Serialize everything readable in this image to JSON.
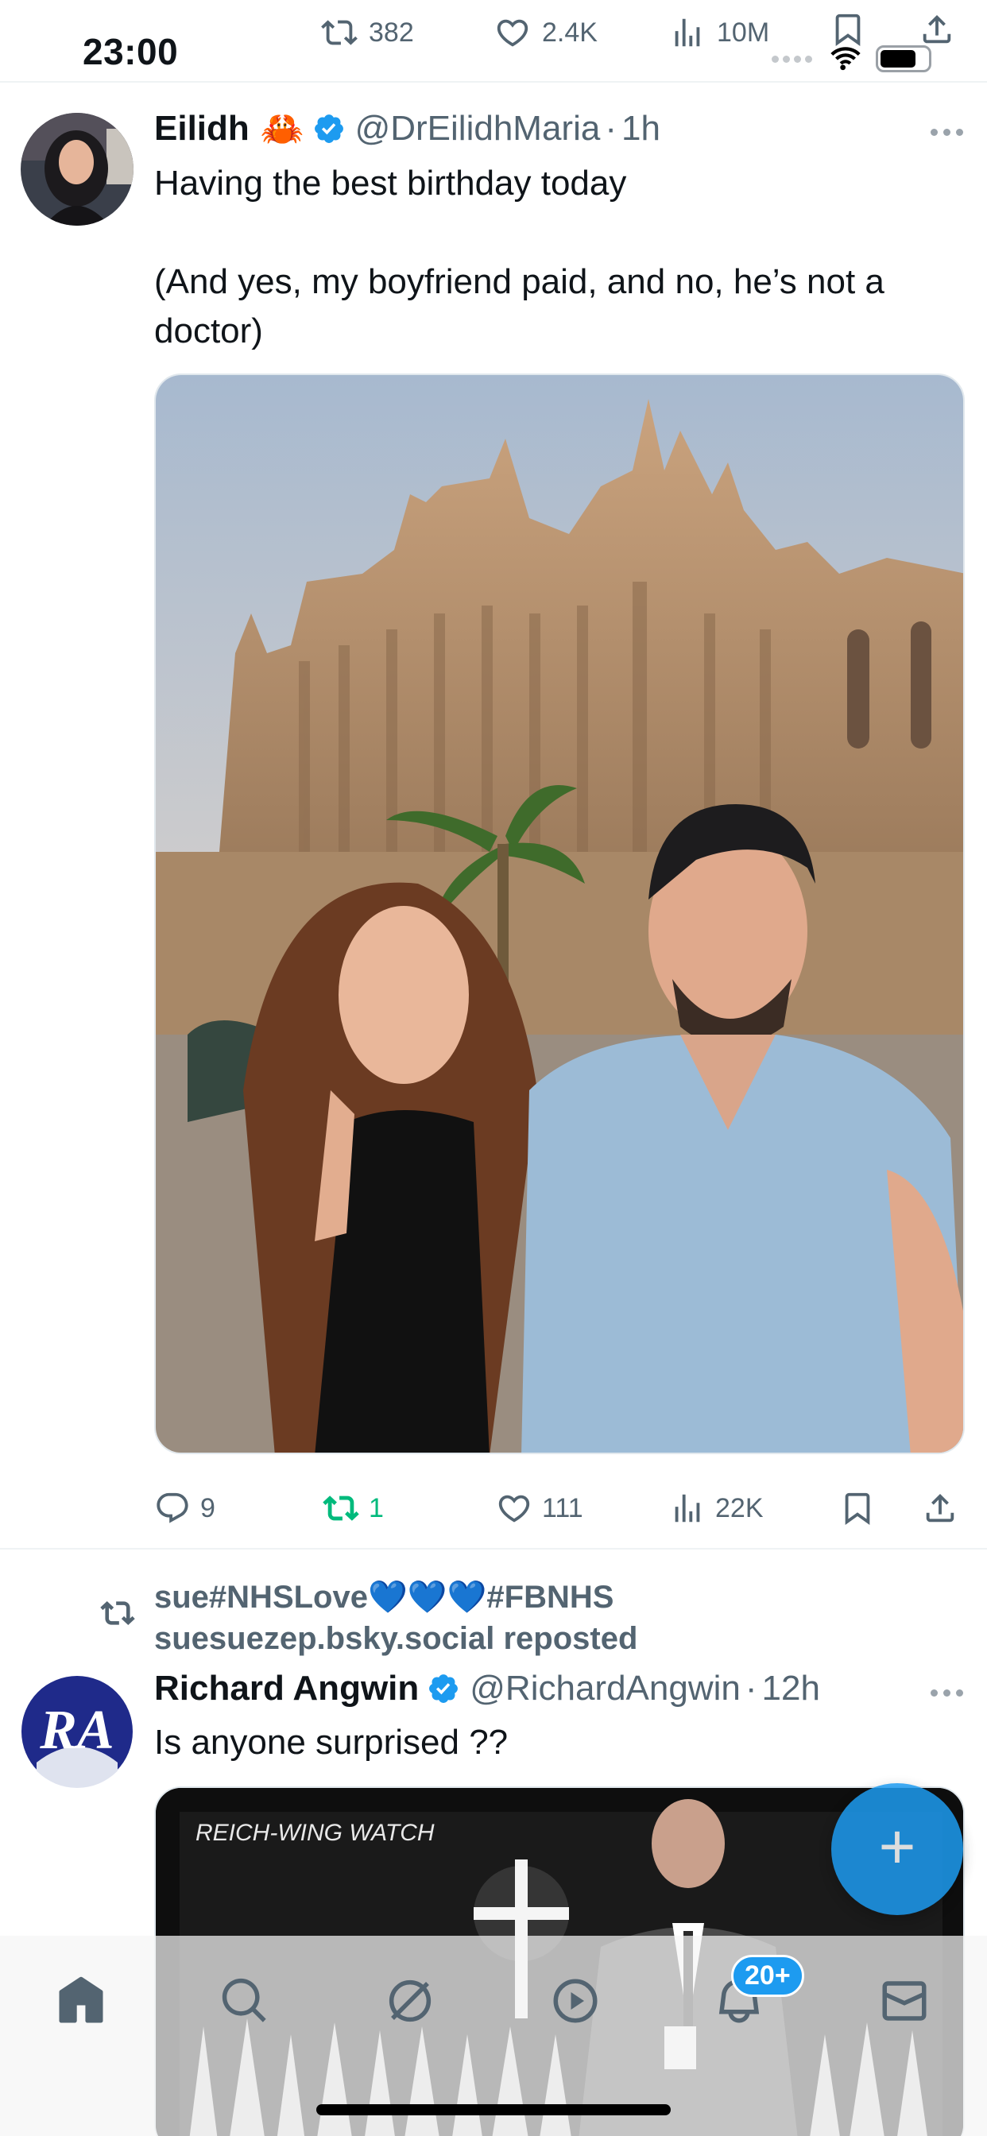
{
  "status_bar": {
    "time": "23:00",
    "stats": {
      "retweets": "382",
      "likes": "2.4K",
      "views": "10M"
    }
  },
  "tweets": [
    {
      "name": "Eilidh",
      "name_emoji": "🦀",
      "handle": "@DrEilidhMaria",
      "time": "1h",
      "text_line1": "Having the best birthday today",
      "text_line2": "(And yes, my boyfriend paid, and no, he’s not a doctor)",
      "actions": {
        "replies": "9",
        "retweets": "1",
        "likes": "111",
        "views": "22K"
      }
    },
    {
      "reposted_by_line1": "sue#NHSLove💙💙💙#FBNHS",
      "reposted_by_line2": "suesuezep.bsky.social reposted",
      "name": "Richard Angwin",
      "handle": "@RichardAngwin",
      "time": "12h",
      "text": "Is anyone surprised ??",
      "media_caption": "REICH-WING WATCH",
      "avatar_letters": "RA"
    }
  ],
  "bottom_nav": {
    "items": [
      "home-icon",
      "search-icon",
      "grok-icon",
      "video-icon",
      "notifications-icon",
      "messages-icon"
    ],
    "notification_badge": "20+"
  },
  "colors": {
    "accent": "#1d9bf0",
    "retweet_green": "#00ba7c",
    "muted": "#536471"
  }
}
